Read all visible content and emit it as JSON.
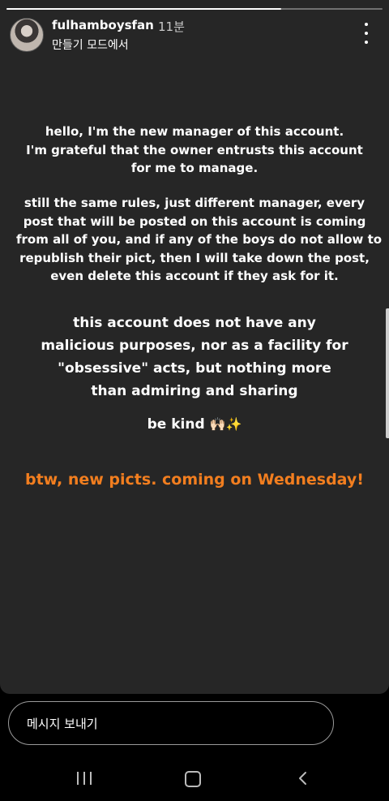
{
  "header": {
    "username": "fulhamboysfan",
    "time": "11분",
    "subtitle": "만들기 모드에서",
    "avatar_icon": "profile-photo",
    "more_icon": "more-vertical-icon",
    "story_progress": 0.73
  },
  "story": {
    "background_color": "#262626",
    "accent_color": "#f27e1f",
    "paragraph1": [
      "hello, I'm the new manager of this account.",
      "I'm grateful that the owner entrusts this account",
      "for me to manage."
    ],
    "paragraph2": [
      "still the same rules, just different manager, every",
      "post that will be posted on this account is coming",
      "from all of you, and if any of the boys do not allow to",
      "republish their pict, then I will take down the post,",
      "even delete this account if they ask for it."
    ],
    "paragraph3": [
      "this account does not have any",
      "malicious purposes, nor as a facility for",
      "\"obsessive\" acts, but nothing more",
      "than admiring and sharing"
    ],
    "closing": "be kind",
    "closing_emojis": "🙌🏻✨",
    "announcement": "btw, new picts. coming on Wednesday!"
  },
  "reply": {
    "placeholder": "메시지 보내기"
  },
  "navigation": {
    "recent_icon": "recent-apps-icon",
    "home_icon": "home-icon",
    "back_icon": "back-icon"
  }
}
